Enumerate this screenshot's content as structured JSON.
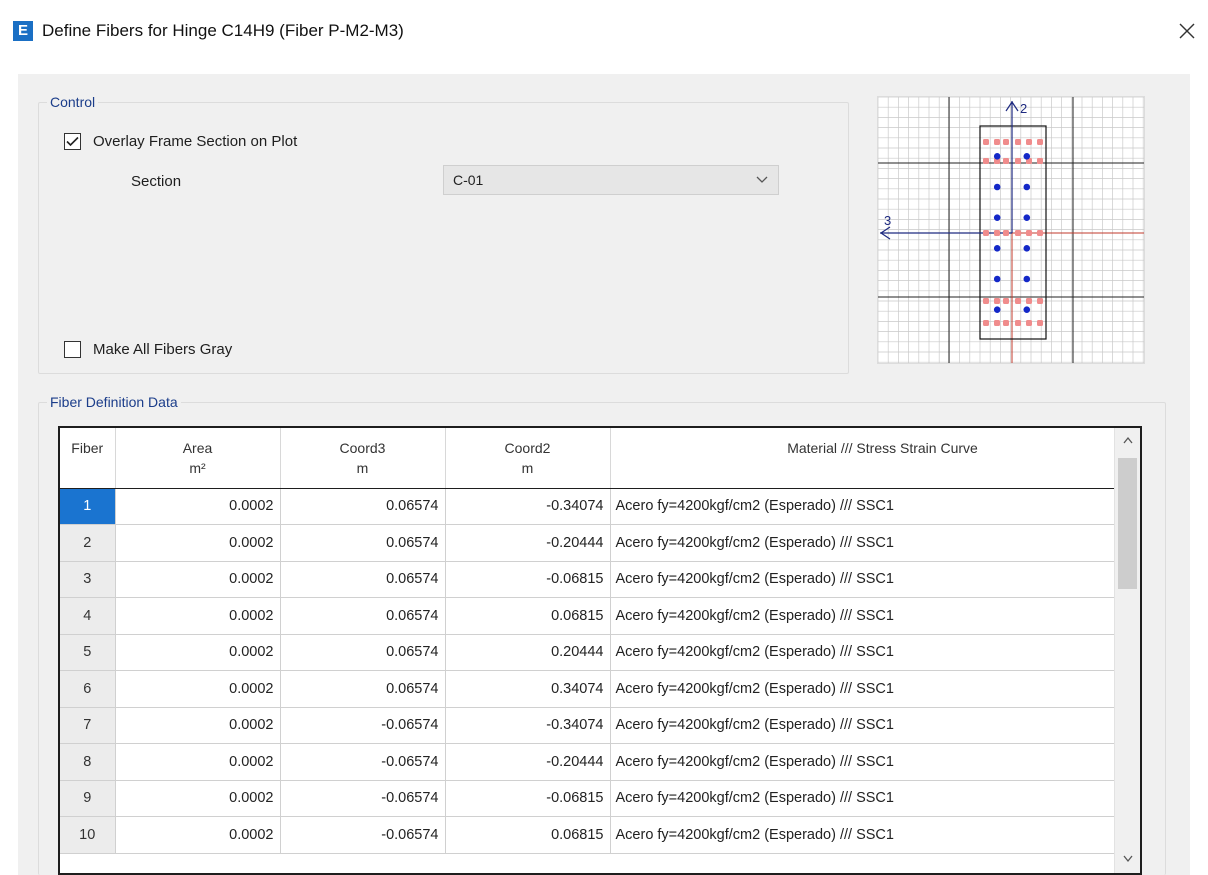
{
  "window": {
    "app_icon_letter": "E",
    "title": "Define Fibers for Hinge C14H9  (Fiber P-M2-M3)"
  },
  "control": {
    "legend": "Control",
    "overlay_checkbox": {
      "label": "Overlay Frame Section on Plot",
      "checked": true
    },
    "section_label": "Section",
    "section_value": "C-01",
    "gray_checkbox": {
      "label": "Make All Fibers Gray",
      "checked": false
    }
  },
  "plot": {
    "axis2_label": "2",
    "axis3_label": "3"
  },
  "fiber_data": {
    "legend": "Fiber Definition Data",
    "columns": [
      {
        "line1": "Fiber",
        "line2": ""
      },
      {
        "line1": "Area",
        "line2": "m²"
      },
      {
        "line1": "Coord3",
        "line2": "m"
      },
      {
        "line1": "Coord2",
        "line2": "m"
      },
      {
        "line1": "Material  ///  Stress Strain Curve",
        "line2": ""
      }
    ],
    "rows": [
      {
        "fiber": "1",
        "area": "0.0002",
        "coord3": "0.06574",
        "coord2": "-0.34074",
        "material": "Acero fy=4200kgf/cm2 (Esperado)  ///  SSC1"
      },
      {
        "fiber": "2",
        "area": "0.0002",
        "coord3": "0.06574",
        "coord2": "-0.20444",
        "material": "Acero fy=4200kgf/cm2 (Esperado)  ///  SSC1"
      },
      {
        "fiber": "3",
        "area": "0.0002",
        "coord3": "0.06574",
        "coord2": "-0.06815",
        "material": "Acero fy=4200kgf/cm2 (Esperado)  ///  SSC1"
      },
      {
        "fiber": "4",
        "area": "0.0002",
        "coord3": "0.06574",
        "coord2": "0.06815",
        "material": "Acero fy=4200kgf/cm2 (Esperado)  ///  SSC1"
      },
      {
        "fiber": "5",
        "area": "0.0002",
        "coord3": "0.06574",
        "coord2": "0.20444",
        "material": "Acero fy=4200kgf/cm2 (Esperado)  ///  SSC1"
      },
      {
        "fiber": "6",
        "area": "0.0002",
        "coord3": "0.06574",
        "coord2": "0.34074",
        "material": "Acero fy=4200kgf/cm2 (Esperado)  ///  SSC1"
      },
      {
        "fiber": "7",
        "area": "0.0002",
        "coord3": "-0.06574",
        "coord2": "-0.34074",
        "material": "Acero fy=4200kgf/cm2 (Esperado)  ///  SSC1"
      },
      {
        "fiber": "8",
        "area": "0.0002",
        "coord3": "-0.06574",
        "coord2": "-0.20444",
        "material": "Acero fy=4200kgf/cm2 (Esperado)  ///  SSC1"
      },
      {
        "fiber": "9",
        "area": "0.0002",
        "coord3": "-0.06574",
        "coord2": "-0.06815",
        "material": "Acero fy=4200kgf/cm2 (Esperado)  ///  SSC1"
      },
      {
        "fiber": "10",
        "area": "0.0002",
        "coord3": "-0.06574",
        "coord2": "0.06815",
        "material": "Acero fy=4200kgf/cm2 (Esperado)  ///  SSC1"
      }
    ],
    "selected_row": 0
  },
  "colors": {
    "accent": "#1a74d0",
    "legend_text": "#1b3d8a",
    "steel_fiber": "#1428c8",
    "concrete_fiber": "#f08c8c",
    "axis_line": "#1e2a80",
    "axis_red": "#c0392b"
  },
  "icons": {
    "close": "close-icon",
    "combo_arrow": "chevron-down-icon",
    "check": "checkmark-icon"
  }
}
